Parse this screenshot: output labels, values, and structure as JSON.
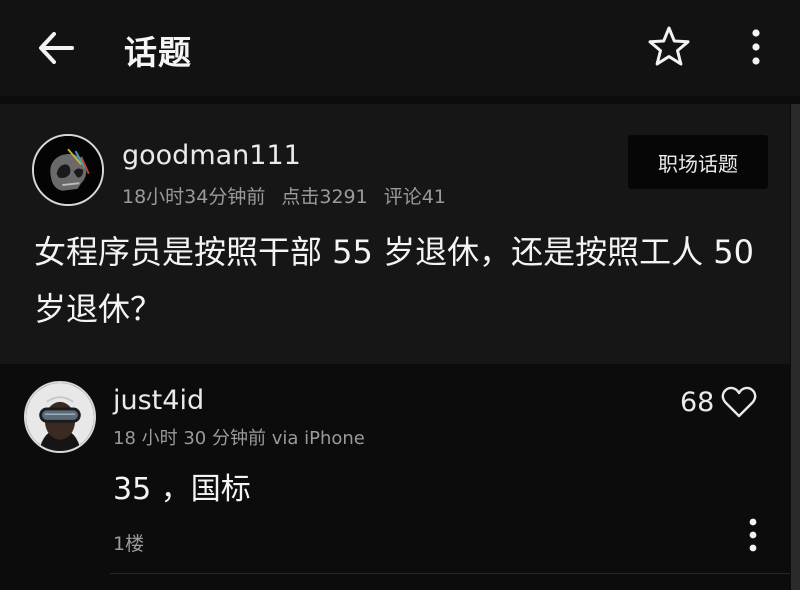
{
  "appbar": {
    "title": "话题",
    "icons": [
      "back-arrow-icon",
      "star-icon",
      "more-vertical-icon"
    ]
  },
  "post": {
    "author": "goodman111",
    "time": "18小时34分钟前",
    "clicks": "点击3291",
    "comments": "评论41",
    "tag": "职场话题",
    "text": "女程序员是按照干部 55 岁退休，还是按照工人 50 岁退休？"
  },
  "comments": [
    {
      "author": "just4id",
      "meta": "18 小时 30 分钟前 via iPhone",
      "text": "35 ，国标",
      "floor": "1楼",
      "likes": "68"
    }
  ],
  "colors": {
    "background": "#0c0c0c",
    "surface": "#161616",
    "text": "#f2f2f2",
    "muted": "#9a9a9a"
  }
}
